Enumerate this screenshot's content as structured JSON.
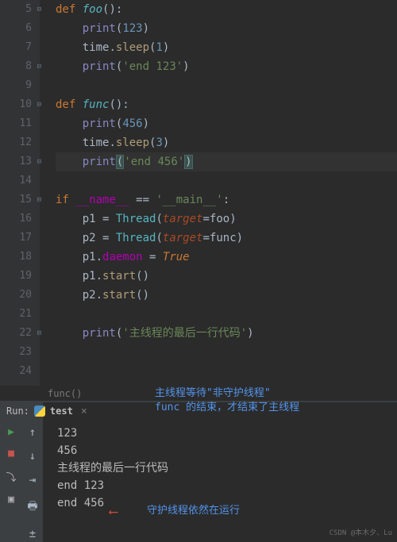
{
  "lines": [
    {
      "n": "5"
    },
    {
      "n": "6"
    },
    {
      "n": "7"
    },
    {
      "n": "8"
    },
    {
      "n": "9"
    },
    {
      "n": "10"
    },
    {
      "n": "11"
    },
    {
      "n": "12"
    },
    {
      "n": "13"
    },
    {
      "n": "14"
    },
    {
      "n": "15"
    },
    {
      "n": "16"
    },
    {
      "n": "17"
    },
    {
      "n": "18"
    },
    {
      "n": "19"
    },
    {
      "n": "20"
    },
    {
      "n": "21"
    },
    {
      "n": "22"
    },
    {
      "n": "23"
    },
    {
      "n": "24"
    }
  ],
  "code": {
    "l5": {
      "def": "def ",
      "name": "foo",
      "paren": "():"
    },
    "l6": {
      "pr": "print",
      "lp": "(",
      "v": "123",
      "rp": ")"
    },
    "l7": {
      "obj": "time",
      "dot": ".",
      "m": "sleep",
      "lp": "(",
      "v": "1",
      "rp": ")"
    },
    "l8": {
      "pr": "print",
      "lp": "(",
      "s": "'end 123'",
      "rp": ")"
    },
    "l10": {
      "def": "def ",
      "name": "func",
      "paren": "():"
    },
    "l11": {
      "pr": "print",
      "lp": "(",
      "v": "456",
      "rp": ")"
    },
    "l12": {
      "obj": "time",
      "dot": ".",
      "m": "sleep",
      "lp": "(",
      "v": "3",
      "rp": ")"
    },
    "l13": {
      "pr": "print",
      "lp": "(",
      "s": "'end 456'",
      "rp": ")"
    },
    "l15": {
      "if": "if ",
      "name": "__name__",
      "eq": " == ",
      "s": "'__main__'",
      "c": ":"
    },
    "l16": {
      "v": "p1",
      "eq": " = ",
      "cls": "Thread",
      "lp": "(",
      "p": "target",
      "a": "=",
      "f": "foo",
      "rp": ")"
    },
    "l17": {
      "v": "p2",
      "eq": " = ",
      "cls": "Thread",
      "lp": "(",
      "p": "target",
      "a": "=",
      "f": "func",
      "rp": ")"
    },
    "l18": {
      "v": "p1",
      "dot": ".",
      "prop": "daemon",
      "eq": " = ",
      "tv": "True"
    },
    "l19": {
      "v": "p1",
      "dot": ".",
      "m": "start",
      "paren": "()"
    },
    "l20": {
      "v": "p2",
      "dot": ".",
      "m": "start",
      "paren": "()"
    },
    "l22": {
      "pr": "print",
      "lp": "(",
      "s": "'主线程的最后一行代码'",
      "rp": ")"
    }
  },
  "breadcrumb": "func()",
  "annotation1_l1": "主线程等待\"非守护线程\"",
  "annotation1_l2": "func 的结束，才结束了主线程",
  "run": {
    "label": "Run:",
    "tab": "test",
    "out": [
      "123",
      "456",
      "主线程的最后一行代码",
      "end 123",
      "end 456"
    ]
  },
  "annotation2": "守护线程依然在运行",
  "watermark": "CSDN @本木夕、Lu"
}
